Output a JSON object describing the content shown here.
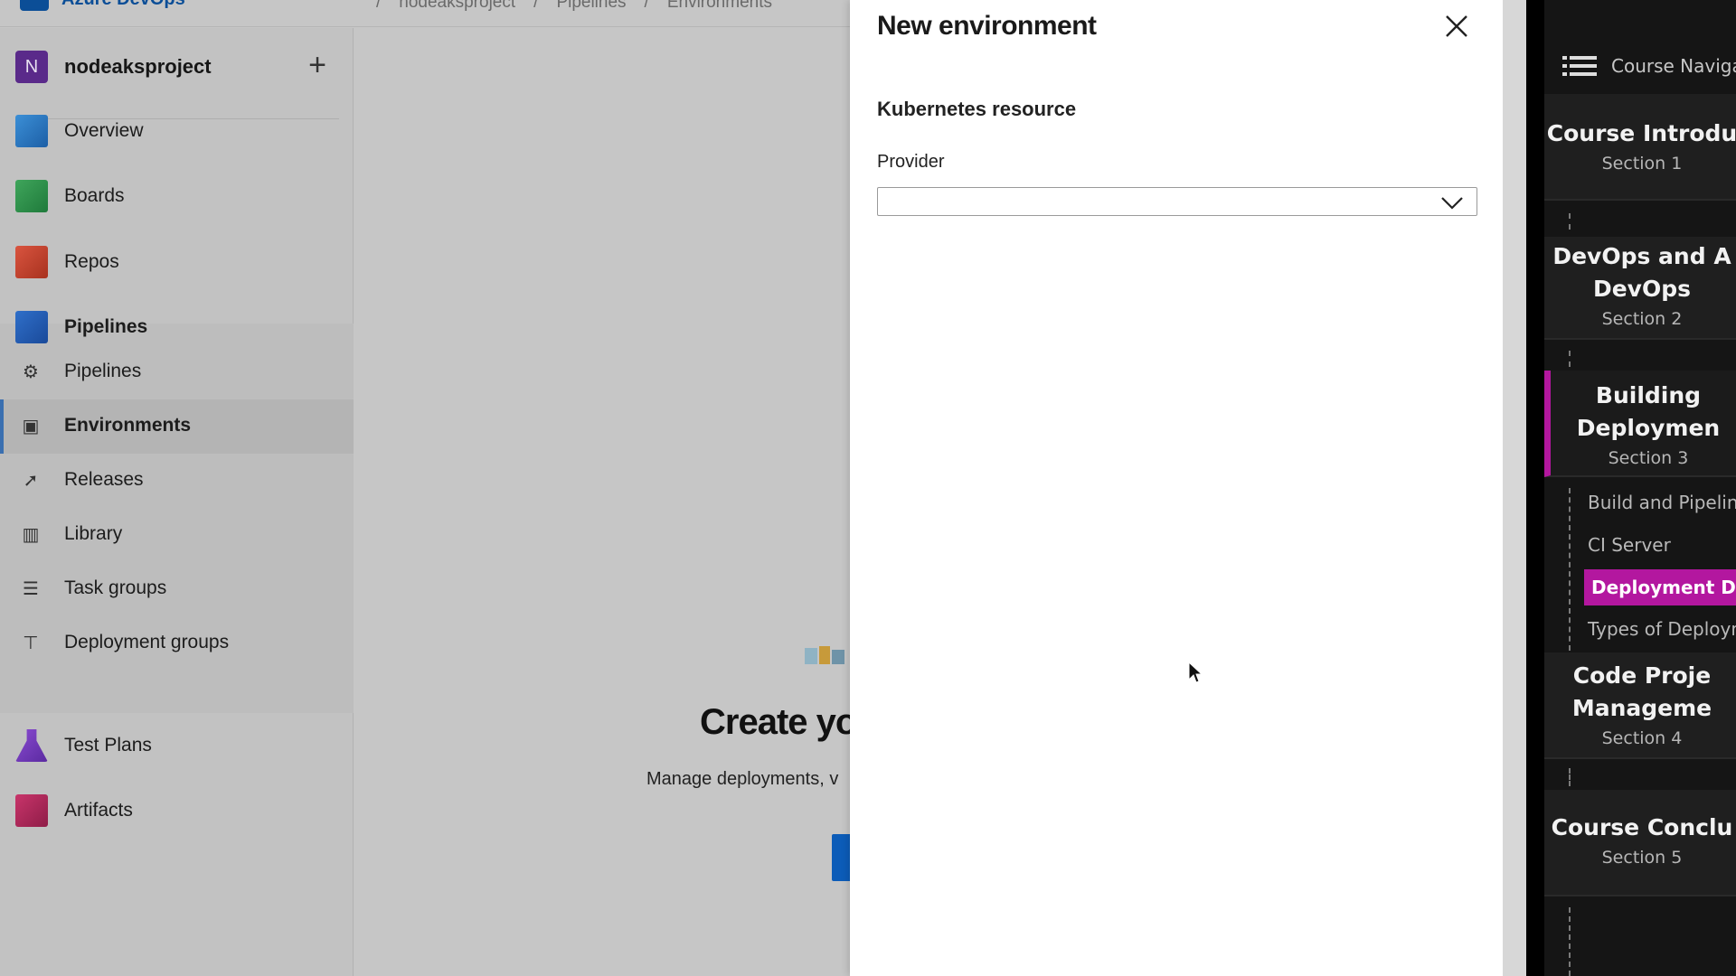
{
  "topbar": {
    "brand": "Azure DevOps",
    "breadcrumbs": [
      "nodeaksproject",
      "Pipelines",
      "Environments"
    ],
    "separators": [
      "/",
      "/",
      "/"
    ]
  },
  "sidebar": {
    "project_initial": "N",
    "project_name": "nodeaksproject",
    "add_label": "+",
    "items": [
      {
        "label": "Overview",
        "icon": "overview-icon"
      },
      {
        "label": "Boards",
        "icon": "boards-icon"
      },
      {
        "label": "Repos",
        "icon": "repos-icon"
      },
      {
        "label": "Pipelines",
        "icon": "pipelines-icon"
      },
      {
        "label": "Test Plans",
        "icon": "test-plans-icon"
      },
      {
        "label": "Artifacts",
        "icon": "artifacts-icon"
      }
    ],
    "pipelines_sub": [
      {
        "label": "Pipelines",
        "icon": "pipelines-sub-icon"
      },
      {
        "label": "Environments",
        "icon": "environments-icon"
      },
      {
        "label": "Releases",
        "icon": "rocket-icon"
      },
      {
        "label": "Library",
        "icon": "library-icon"
      },
      {
        "label": "Task groups",
        "icon": "task-groups-icon"
      },
      {
        "label": "Deployment groups",
        "icon": "deployment-groups-icon"
      }
    ]
  },
  "center": {
    "hero_title": "Create yo",
    "hero_subtitle": "Manage deployments, v"
  },
  "dialog": {
    "title": "New environment",
    "section": "Kubernetes resource",
    "provider_label": "Provider",
    "provider_value": ""
  },
  "course": {
    "header": "Course Navigation",
    "sections": [
      {
        "title_lines": [
          "Course Introdu"
        ],
        "section": "Section 1"
      },
      {
        "title_lines": [
          "DevOps and A",
          "DevOps"
        ],
        "section": "Section 2"
      },
      {
        "title_lines": [
          "Building",
          "Deploymen"
        ],
        "section": "Section 3"
      },
      {
        "title_lines": [
          "Code Proje",
          "Manageme"
        ],
        "section": "Section 4"
      },
      {
        "title_lines": [
          "Course Conclu"
        ],
        "section": "Section 5"
      }
    ],
    "lessons": [
      "Build and Pipeline",
      "CI Server",
      "Deployment Det",
      "Types of Deploym"
    ]
  },
  "colors": {
    "accent_blue": "#0c5cb8",
    "course_highlight": "#b3179f",
    "project_avatar": "#5a2a8a"
  }
}
